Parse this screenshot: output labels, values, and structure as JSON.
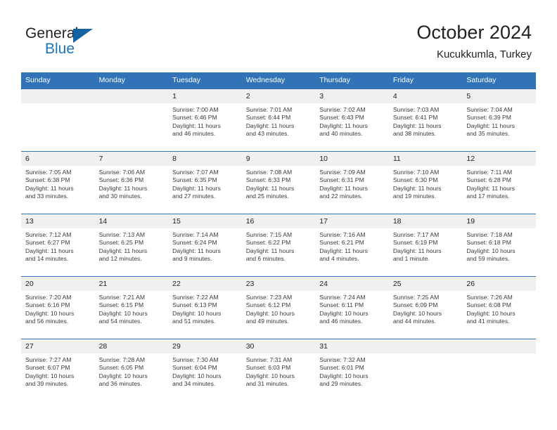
{
  "brand": {
    "name_part1": "General",
    "name_part2": "Blue",
    "triangle_icon": "blue-triangle-icon",
    "colors": {
      "dark": "#231f20",
      "blue": "#1b75bb",
      "triangle": "#1464a5"
    }
  },
  "header": {
    "title": "October 2024",
    "subtitle": "Kucukkumla, Turkey"
  },
  "calendar": {
    "accent_color": "#3173b6",
    "daynum_band_color": "#f0f0f0",
    "weekday_headers": [
      "Sunday",
      "Monday",
      "Tuesday",
      "Wednesday",
      "Thursday",
      "Friday",
      "Saturday"
    ],
    "weeks": [
      [
        {
          "day": "",
          "blank": true,
          "sunrise": "",
          "sunset": "",
          "daylight_line1": "",
          "daylight_line2": ""
        },
        {
          "day": "",
          "blank": true,
          "sunrise": "",
          "sunset": "",
          "daylight_line1": "",
          "daylight_line2": ""
        },
        {
          "day": "1",
          "sunrise": "Sunrise: 7:00 AM",
          "sunset": "Sunset: 6:46 PM",
          "daylight_line1": "Daylight: 11 hours",
          "daylight_line2": "and 46 minutes."
        },
        {
          "day": "2",
          "sunrise": "Sunrise: 7:01 AM",
          "sunset": "Sunset: 6:44 PM",
          "daylight_line1": "Daylight: 11 hours",
          "daylight_line2": "and 43 minutes."
        },
        {
          "day": "3",
          "sunrise": "Sunrise: 7:02 AM",
          "sunset": "Sunset: 6:43 PM",
          "daylight_line1": "Daylight: 11 hours",
          "daylight_line2": "and 40 minutes."
        },
        {
          "day": "4",
          "sunrise": "Sunrise: 7:03 AM",
          "sunset": "Sunset: 6:41 PM",
          "daylight_line1": "Daylight: 11 hours",
          "daylight_line2": "and 38 minutes."
        },
        {
          "day": "5",
          "sunrise": "Sunrise: 7:04 AM",
          "sunset": "Sunset: 6:39 PM",
          "daylight_line1": "Daylight: 11 hours",
          "daylight_line2": "and 35 minutes."
        }
      ],
      [
        {
          "day": "6",
          "sunrise": "Sunrise: 7:05 AM",
          "sunset": "Sunset: 6:38 PM",
          "daylight_line1": "Daylight: 11 hours",
          "daylight_line2": "and 33 minutes."
        },
        {
          "day": "7",
          "sunrise": "Sunrise: 7:06 AM",
          "sunset": "Sunset: 6:36 PM",
          "daylight_line1": "Daylight: 11 hours",
          "daylight_line2": "and 30 minutes."
        },
        {
          "day": "8",
          "sunrise": "Sunrise: 7:07 AM",
          "sunset": "Sunset: 6:35 PM",
          "daylight_line1": "Daylight: 11 hours",
          "daylight_line2": "and 27 minutes."
        },
        {
          "day": "9",
          "sunrise": "Sunrise: 7:08 AM",
          "sunset": "Sunset: 6:33 PM",
          "daylight_line1": "Daylight: 11 hours",
          "daylight_line2": "and 25 minutes."
        },
        {
          "day": "10",
          "sunrise": "Sunrise: 7:09 AM",
          "sunset": "Sunset: 6:31 PM",
          "daylight_line1": "Daylight: 11 hours",
          "daylight_line2": "and 22 minutes."
        },
        {
          "day": "11",
          "sunrise": "Sunrise: 7:10 AM",
          "sunset": "Sunset: 6:30 PM",
          "daylight_line1": "Daylight: 11 hours",
          "daylight_line2": "and 19 minutes."
        },
        {
          "day": "12",
          "sunrise": "Sunrise: 7:11 AM",
          "sunset": "Sunset: 6:28 PM",
          "daylight_line1": "Daylight: 11 hours",
          "daylight_line2": "and 17 minutes."
        }
      ],
      [
        {
          "day": "13",
          "sunrise": "Sunrise: 7:12 AM",
          "sunset": "Sunset: 6:27 PM",
          "daylight_line1": "Daylight: 11 hours",
          "daylight_line2": "and 14 minutes."
        },
        {
          "day": "14",
          "sunrise": "Sunrise: 7:13 AM",
          "sunset": "Sunset: 6:25 PM",
          "daylight_line1": "Daylight: 11 hours",
          "daylight_line2": "and 12 minutes."
        },
        {
          "day": "15",
          "sunrise": "Sunrise: 7:14 AM",
          "sunset": "Sunset: 6:24 PM",
          "daylight_line1": "Daylight: 11 hours",
          "daylight_line2": "and 9 minutes."
        },
        {
          "day": "16",
          "sunrise": "Sunrise: 7:15 AM",
          "sunset": "Sunset: 6:22 PM",
          "daylight_line1": "Daylight: 11 hours",
          "daylight_line2": "and 6 minutes."
        },
        {
          "day": "17",
          "sunrise": "Sunrise: 7:16 AM",
          "sunset": "Sunset: 6:21 PM",
          "daylight_line1": "Daylight: 11 hours",
          "daylight_line2": "and 4 minutes."
        },
        {
          "day": "18",
          "sunrise": "Sunrise: 7:17 AM",
          "sunset": "Sunset: 6:19 PM",
          "daylight_line1": "Daylight: 11 hours",
          "daylight_line2": "and 1 minute."
        },
        {
          "day": "19",
          "sunrise": "Sunrise: 7:18 AM",
          "sunset": "Sunset: 6:18 PM",
          "daylight_line1": "Daylight: 10 hours",
          "daylight_line2": "and 59 minutes."
        }
      ],
      [
        {
          "day": "20",
          "sunrise": "Sunrise: 7:20 AM",
          "sunset": "Sunset: 6:16 PM",
          "daylight_line1": "Daylight: 10 hours",
          "daylight_line2": "and 56 minutes."
        },
        {
          "day": "21",
          "sunrise": "Sunrise: 7:21 AM",
          "sunset": "Sunset: 6:15 PM",
          "daylight_line1": "Daylight: 10 hours",
          "daylight_line2": "and 54 minutes."
        },
        {
          "day": "22",
          "sunrise": "Sunrise: 7:22 AM",
          "sunset": "Sunset: 6:13 PM",
          "daylight_line1": "Daylight: 10 hours",
          "daylight_line2": "and 51 minutes."
        },
        {
          "day": "23",
          "sunrise": "Sunrise: 7:23 AM",
          "sunset": "Sunset: 6:12 PM",
          "daylight_line1": "Daylight: 10 hours",
          "daylight_line2": "and 49 minutes."
        },
        {
          "day": "24",
          "sunrise": "Sunrise: 7:24 AM",
          "sunset": "Sunset: 6:11 PM",
          "daylight_line1": "Daylight: 10 hours",
          "daylight_line2": "and 46 minutes."
        },
        {
          "day": "25",
          "sunrise": "Sunrise: 7:25 AM",
          "sunset": "Sunset: 6:09 PM",
          "daylight_line1": "Daylight: 10 hours",
          "daylight_line2": "and 44 minutes."
        },
        {
          "day": "26",
          "sunrise": "Sunrise: 7:26 AM",
          "sunset": "Sunset: 6:08 PM",
          "daylight_line1": "Daylight: 10 hours",
          "daylight_line2": "and 41 minutes."
        }
      ],
      [
        {
          "day": "27",
          "sunrise": "Sunrise: 7:27 AM",
          "sunset": "Sunset: 6:07 PM",
          "daylight_line1": "Daylight: 10 hours",
          "daylight_line2": "and 39 minutes."
        },
        {
          "day": "28",
          "sunrise": "Sunrise: 7:28 AM",
          "sunset": "Sunset: 6:05 PM",
          "daylight_line1": "Daylight: 10 hours",
          "daylight_line2": "and 36 minutes."
        },
        {
          "day": "29",
          "sunrise": "Sunrise: 7:30 AM",
          "sunset": "Sunset: 6:04 PM",
          "daylight_line1": "Daylight: 10 hours",
          "daylight_line2": "and 34 minutes."
        },
        {
          "day": "30",
          "sunrise": "Sunrise: 7:31 AM",
          "sunset": "Sunset: 6:03 PM",
          "daylight_line1": "Daylight: 10 hours",
          "daylight_line2": "and 31 minutes."
        },
        {
          "day": "31",
          "sunrise": "Sunrise: 7:32 AM",
          "sunset": "Sunset: 6:01 PM",
          "daylight_line1": "Daylight: 10 hours",
          "daylight_line2": "and 29 minutes."
        },
        {
          "day": "",
          "blank": true,
          "sunrise": "",
          "sunset": "",
          "daylight_line1": "",
          "daylight_line2": ""
        },
        {
          "day": "",
          "blank": true,
          "sunrise": "",
          "sunset": "",
          "daylight_line1": "",
          "daylight_line2": ""
        }
      ]
    ]
  }
}
